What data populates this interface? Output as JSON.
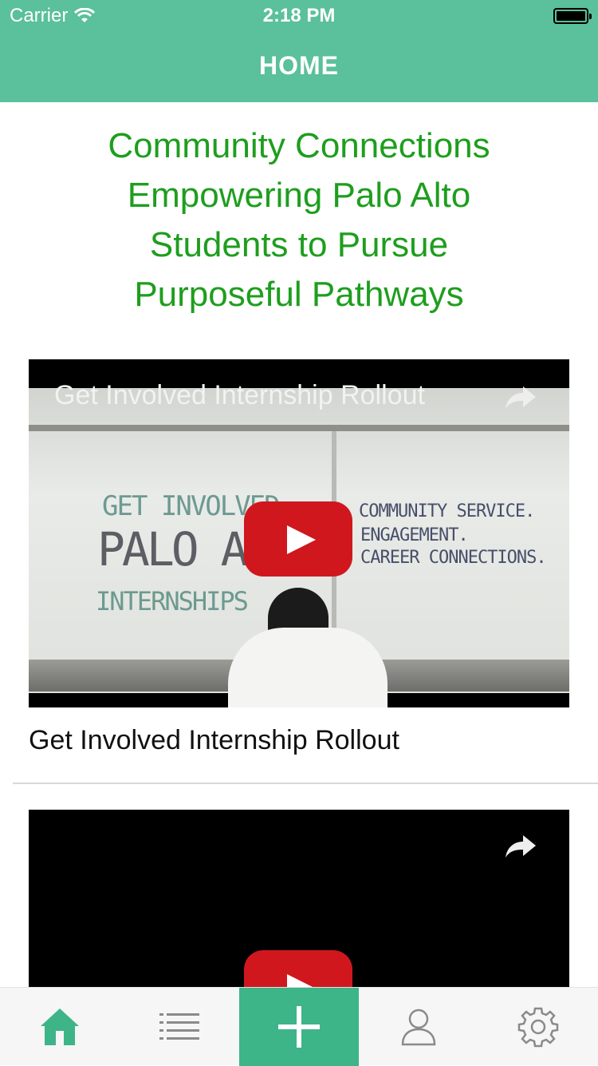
{
  "status_bar": {
    "carrier": "Carrier",
    "time": "2:18 PM"
  },
  "nav": {
    "title": "HOME"
  },
  "tagline": {
    "lines": [
      "Community Connections",
      "Empowering Palo Alto",
      "Students to Pursue",
      "Purposeful Pathways"
    ]
  },
  "videos": [
    {
      "title": "Get Involved Internship Rollout",
      "caption": "Get Involved Internship Rollout",
      "board_text": [
        "GET INVOLVED",
        "PALO ALTO",
        "INTERNSHIPS",
        "COMMUNITY SERVICE.",
        "ENGAGEMENT.",
        "CAREER CONNECTIONS."
      ]
    },
    {
      "title": "",
      "caption": ""
    }
  ],
  "tabbar": {
    "items": [
      {
        "icon": "home-icon",
        "active": true
      },
      {
        "icon": "list-icon",
        "active": false
      },
      {
        "icon": "plus-icon",
        "active": false
      },
      {
        "icon": "person-icon",
        "active": false
      },
      {
        "icon": "gear-icon",
        "active": false
      }
    ]
  },
  "colors": {
    "header": "#5bc09c",
    "tagline": "#1e9e1e",
    "add_tab": "#3eb489",
    "youtube_red": "#d0171e"
  }
}
